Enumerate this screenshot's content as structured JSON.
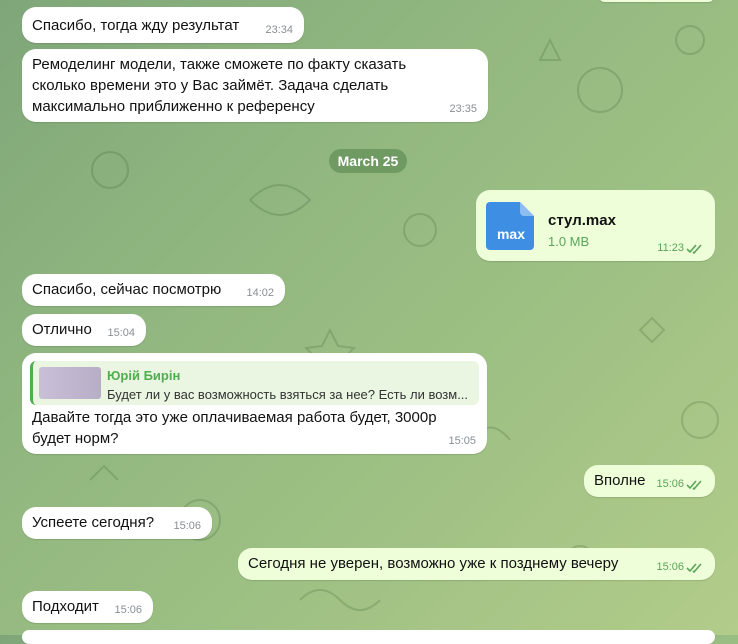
{
  "chat": {
    "date_separator": "March 25",
    "messages": [
      {
        "id": "m1",
        "dir": "in",
        "text": "Спасибо, тогда жду результат",
        "time": "23:34"
      },
      {
        "id": "m2",
        "dir": "in",
        "lines": [
          "Ремоделинг модели, также сможете по факту сказать",
          "сколько времени это у Вас займёт. Задача сделать",
          "максимально приближенно к референсу"
        ],
        "time": "23:35"
      },
      {
        "id": "m3",
        "dir": "out",
        "file": {
          "icon_label": "max",
          "name": "стул.max",
          "size": "1.0 MB"
        },
        "time": "11:23",
        "read": true
      },
      {
        "id": "m4",
        "dir": "in",
        "text": "Спасибо, сейчас посмотрю",
        "time": "14:02"
      },
      {
        "id": "m5",
        "dir": "in",
        "text": "Отлично",
        "time": "15:04"
      },
      {
        "id": "m6",
        "dir": "in",
        "reply": {
          "author": "Юрій Бирін",
          "text": "Будет ли у вас возможность взяться за нее? Есть ли возм..."
        },
        "lines": [
          "Давайте тогда это уже оплачиваемая работа будет, 3000р",
          "будет норм?"
        ],
        "time": "15:05"
      },
      {
        "id": "m7",
        "dir": "out",
        "text": "Вполне",
        "time": "15:06",
        "read": true
      },
      {
        "id": "m8",
        "dir": "in",
        "text": "Успеете сегодня?",
        "time": "15:06"
      },
      {
        "id": "m9",
        "dir": "out",
        "text": "Сегодня не уверен, возможно уже к позднему вечеру",
        "time": "15:06",
        "read": true
      },
      {
        "id": "m10",
        "dir": "in",
        "text": "Подходит",
        "time": "15:06"
      }
    ]
  },
  "colors": {
    "accent": "#4fae4e",
    "outgoing_bubble": "#eefed9",
    "file_icon": "#3e8ee4"
  }
}
